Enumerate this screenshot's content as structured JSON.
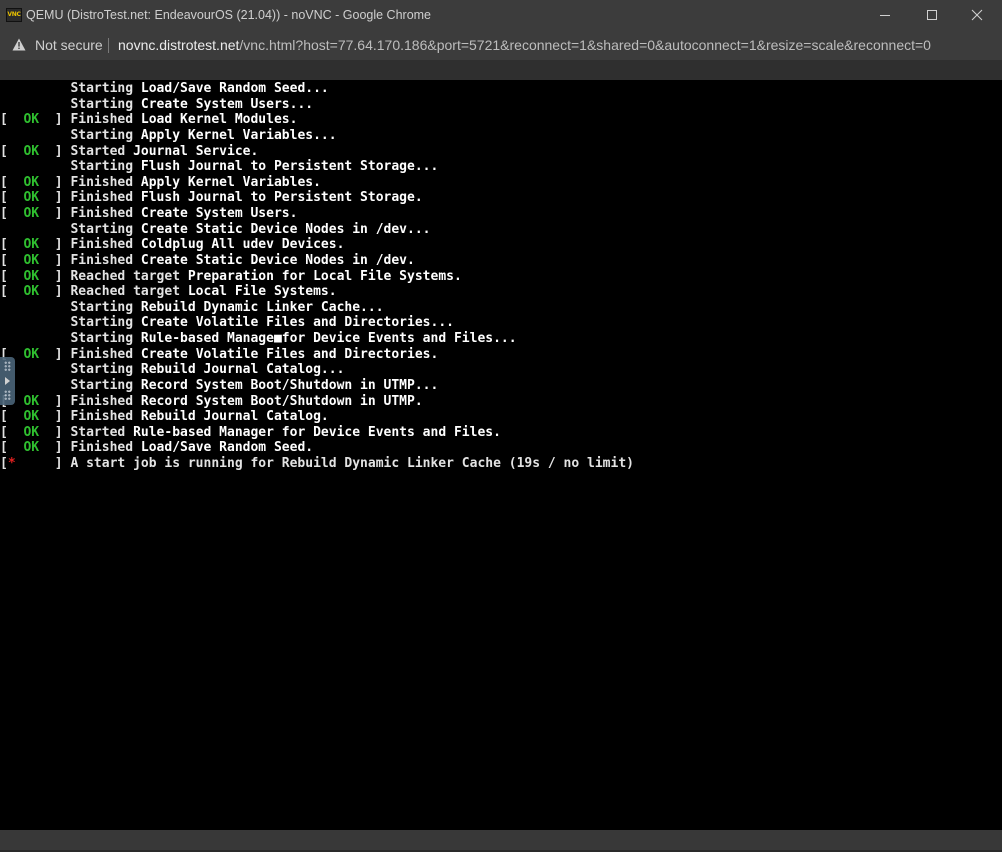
{
  "window": {
    "title": "QEMU (DistroTest.net: EndeavourOS (21.04)) - noVNC - Google Chrome",
    "app_icon_text": "VNC"
  },
  "addressbar": {
    "security_label": "Not secure",
    "url_host": "novnc.distrotest.net",
    "url_path": "/vnc.html?host=77.64.170.186&port=5721&reconnect=1&shared=0&autoconnect=1&resize=scale&reconnect=0"
  },
  "console": {
    "lines": [
      {
        "status": "",
        "verb": "Starting",
        "text": "Load/Save Random Seed..."
      },
      {
        "status": "",
        "verb": "Starting",
        "text": "Create System Users..."
      },
      {
        "status": "OK",
        "verb": "Finished",
        "text": "Load Kernel Modules."
      },
      {
        "status": "",
        "verb": "Starting",
        "text": "Apply Kernel Variables..."
      },
      {
        "status": "OK",
        "verb": "Started",
        "text": "Journal Service."
      },
      {
        "status": "",
        "verb": "Starting",
        "text": "Flush Journal to Persistent Storage..."
      },
      {
        "status": "OK",
        "verb": "Finished",
        "text": "Apply Kernel Variables."
      },
      {
        "status": "OK",
        "verb": "Finished",
        "text": "Flush Journal to Persistent Storage."
      },
      {
        "status": "OK",
        "verb": "Finished",
        "text": "Create System Users."
      },
      {
        "status": "",
        "verb": "Starting",
        "text": "Create Static Device Nodes in /dev..."
      },
      {
        "status": "OK",
        "verb": "Finished",
        "text": "Coldplug All udev Devices."
      },
      {
        "status": "OK",
        "verb": "Finished",
        "text": "Create Static Device Nodes in /dev."
      },
      {
        "status": "OK",
        "verb": "Reached target",
        "text": "Preparation for Local File Systems."
      },
      {
        "status": "OK",
        "verb": "Reached target",
        "text": "Local File Systems."
      },
      {
        "status": "",
        "verb": "Starting",
        "text": "Rebuild Dynamic Linker Cache..."
      },
      {
        "status": "",
        "verb": "Starting",
        "text": "Create Volatile Files and Directories..."
      },
      {
        "status": "",
        "verb": "Starting",
        "text": "Rule-based Manage■for Device Events and Files..."
      },
      {
        "status": "OK",
        "verb": "Finished",
        "text": "Create Volatile Files and Directories."
      },
      {
        "status": "",
        "verb": "Starting",
        "text": "Rebuild Journal Catalog..."
      },
      {
        "status": "",
        "verb": "Starting",
        "text": "Record System Boot/Shutdown in UTMP..."
      },
      {
        "status": "OK",
        "verb": "Finished",
        "text": "Record System Boot/Shutdown in UTMP."
      },
      {
        "status": "OK",
        "verb": "Finished",
        "text": "Rebuild Journal Catalog."
      },
      {
        "status": "OK",
        "verb": "Started",
        "text": "Rule-based Manager for Device Events and Files."
      },
      {
        "status": "OK",
        "verb": "Finished",
        "text": "Load/Save Random Seed."
      },
      {
        "status": "*",
        "verb": "A start job is running for Rebuild Dynamic Linker Cache (19s / no limit)",
        "text": ""
      }
    ]
  },
  "colors": {
    "ok": "#2fbf2f",
    "running_star": "#e02020",
    "console_text": "#e3e3e3",
    "chrome_bar": "#3c3c3c"
  }
}
